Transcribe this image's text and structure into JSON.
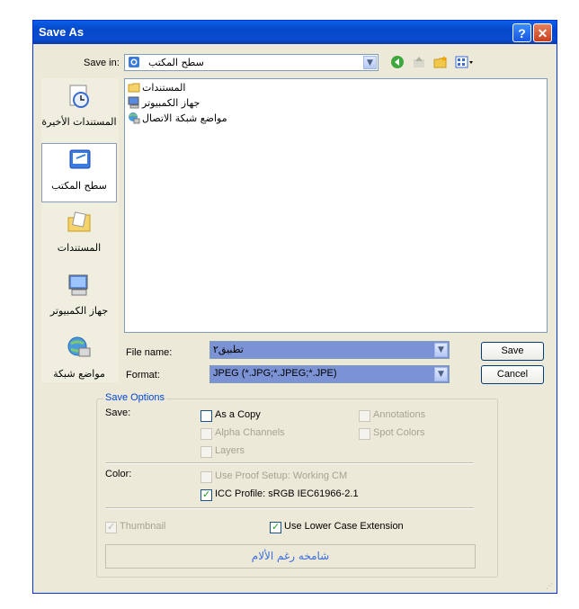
{
  "window": {
    "title": "Save As",
    "help_label": "?",
    "close_label": "✕"
  },
  "save_in": {
    "label": "Save in:",
    "value": "سطح المكتب"
  },
  "toolbar_icons": [
    "back-icon",
    "up-folder-icon",
    "new-folder-icon",
    "views-menu-icon"
  ],
  "places": [
    {
      "label": "المستندات الأخيرة",
      "icon": "recent-documents-icon"
    },
    {
      "label": "سطح المكتب",
      "icon": "desktop-icon",
      "selected": true
    },
    {
      "label": "المستندات",
      "icon": "my-documents-icon"
    },
    {
      "label": "جهاز الكمبيوتر",
      "icon": "my-computer-icon"
    },
    {
      "label": "مواضع شبكة",
      "icon": "network-places-icon"
    }
  ],
  "files": [
    {
      "name": "المستندات",
      "icon": "documents-folder-icon"
    },
    {
      "name": "جهاز الكمبيوتر",
      "icon": "computer-icon"
    },
    {
      "name": "مواضع شبكة الاتصال",
      "icon": "network-icon"
    }
  ],
  "file_name": {
    "label": "File name:",
    "value": "تطبيق٢"
  },
  "format": {
    "label": "Format:",
    "value": "JPEG (*.JPG;*.JPEG;*.JPE)"
  },
  "buttons": {
    "save": "Save",
    "cancel": "Cancel"
  },
  "save_options": {
    "title": "Save Options",
    "save_label": "Save:",
    "as_a_copy": "As a Copy",
    "annotations": "Annotations",
    "alpha_channels": "Alpha Channels",
    "spot_colors": "Spot Colors",
    "layers": "Layers",
    "color_label": "Color:",
    "use_proof_setup": "Use Proof Setup:  Working CM",
    "icc_profile": "ICC Profile:  sRGB IEC61966-2.1",
    "thumbnail": "Thumbnail",
    "lower_case": "Use Lower Case Extension"
  },
  "banner_text": "شامخه رغم الألام"
}
